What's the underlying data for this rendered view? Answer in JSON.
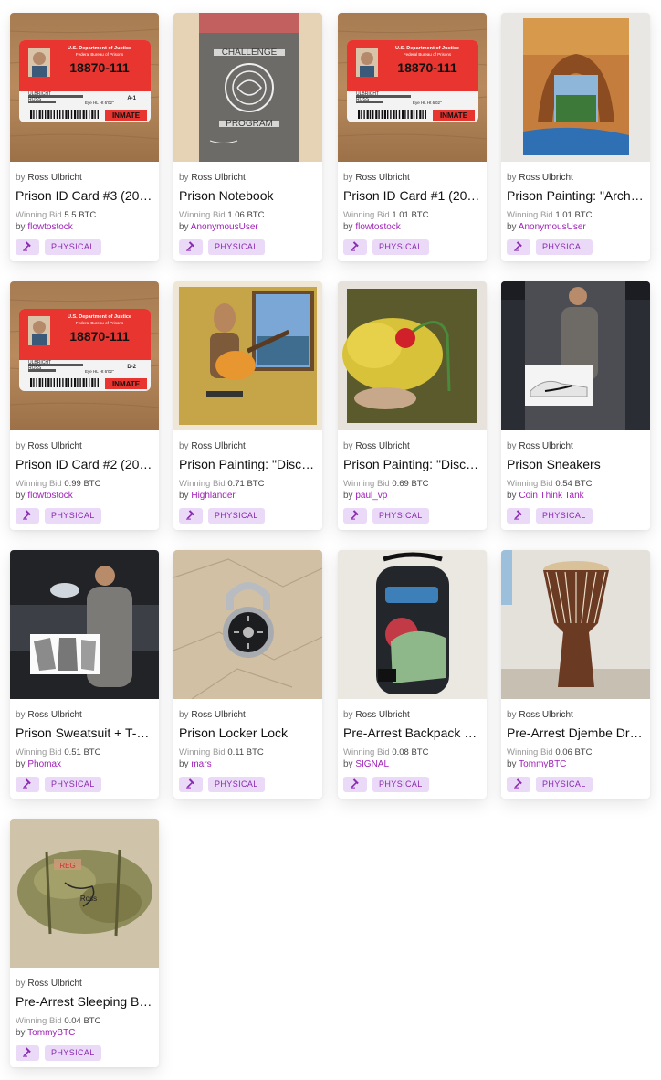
{
  "colors": {
    "accent": "#a020b8",
    "badge_bg": "#ead9f7"
  },
  "labels": {
    "by_prefix": "by",
    "winning_bid": "Winning Bid"
  },
  "items": [
    {
      "artist": "Ross Ulbricht",
      "title": "Prison ID Card #3 (20…",
      "bid": "5.5 BTC",
      "bidder": "flowtostock",
      "tag": "PHYSICAL",
      "thumb": "id-card-photo",
      "id_number": "18870-111",
      "id_header": "U.S. Department of Justice",
      "id_sub": "Federal Bureau of Prisons",
      "id_name1": "ULBRICHT",
      "id_name2": "ROSS",
      "id_detail": "Eye HL   Ht 6'02\"",
      "id_code": "A-1",
      "id_status": "INMATE"
    },
    {
      "artist": "Ross Ulbricht",
      "title": "Prison Notebook",
      "bid": "1.06 BTC",
      "bidder": "AnonymousUser",
      "tag": "PHYSICAL",
      "thumb": "notebook-photo",
      "nb_top": "CHALLENGE",
      "nb_bottom": "PROGRAM"
    },
    {
      "artist": "Ross Ulbricht",
      "title": "Prison ID Card #1 (201…",
      "bid": "1.01 BTC",
      "bidder": "flowtostock",
      "tag": "PHYSICAL",
      "thumb": "id-card-photo",
      "id_number": "18870-111",
      "id_header": "U.S. Department of Justice",
      "id_sub": "Federal Bureau of Prisons",
      "id_name1": "ULBRICHT",
      "id_name2": "ROSS",
      "id_detail": "Eye HL   Ht 6'02\"",
      "id_code": "",
      "id_status": "INMATE"
    },
    {
      "artist": "Ross Ulbricht",
      "title": "Prison Painting: \"Arch…",
      "bid": "1.01 BTC",
      "bidder": "AnonymousUser",
      "tag": "PHYSICAL",
      "thumb": "arch-painting"
    },
    {
      "artist": "Ross Ulbricht",
      "title": "Prison ID Card #2 (20…",
      "bid": "0.99 BTC",
      "bidder": "flowtostock",
      "tag": "PHYSICAL",
      "thumb": "id-card-photo",
      "id_number": "18870-111",
      "id_header": "U.S. Department of Justice",
      "id_sub": "Federal Bureau of Prisons",
      "id_name1": "ULBRICHT",
      "id_name2": "ROSS",
      "id_detail": "Eye HL   Ht 6'02\"",
      "id_code": "D-2",
      "id_status": "INMATE"
    },
    {
      "artist": "Ross Ulbricht",
      "title": "Prison Painting: \"Disco…",
      "bid": "0.71 BTC",
      "bidder": "Highlander",
      "tag": "PHYSICAL",
      "thumb": "guitar-painting"
    },
    {
      "artist": "Ross Ulbricht",
      "title": "Prison Painting: \"Disca…",
      "bid": "0.69 BTC",
      "bidder": "paul_vp",
      "tag": "PHYSICAL",
      "thumb": "rose-painting"
    },
    {
      "artist": "Ross Ulbricht",
      "title": "Prison Sneakers",
      "bid": "0.54 BTC",
      "bidder": "Coin Think Tank",
      "tag": "PHYSICAL",
      "thumb": "sneakers-photo"
    },
    {
      "artist": "Ross Ulbricht",
      "title": "Prison Sweatsuit + T-S…",
      "bid": "0.51 BTC",
      "bidder": "Phomax",
      "tag": "PHYSICAL",
      "thumb": "sweatsuit-photo"
    },
    {
      "artist": "Ross Ulbricht",
      "title": "Prison Locker Lock",
      "bid": "0.11 BTC",
      "bidder": "mars",
      "tag": "PHYSICAL",
      "thumb": "lock-photo"
    },
    {
      "artist": "Ross Ulbricht",
      "title": "Pre-Arrest Backpack …",
      "bid": "0.08 BTC",
      "bidder": "SIGNAL",
      "tag": "PHYSICAL",
      "thumb": "backpack-photo"
    },
    {
      "artist": "Ross Ulbricht",
      "title": "Pre-Arrest Djembe Dr…",
      "bid": "0.06 BTC",
      "bidder": "TommyBTC",
      "tag": "PHYSICAL",
      "thumb": "djembe-photo"
    },
    {
      "artist": "Ross Ulbricht",
      "title": "Pre-Arrest Sleeping B…",
      "bid": "0.04 BTC",
      "bidder": "TommyBTC",
      "tag": "PHYSICAL",
      "thumb": "sleeping-bag-photo",
      "bag_text1": "REG",
      "bag_text2": "Ross"
    }
  ]
}
